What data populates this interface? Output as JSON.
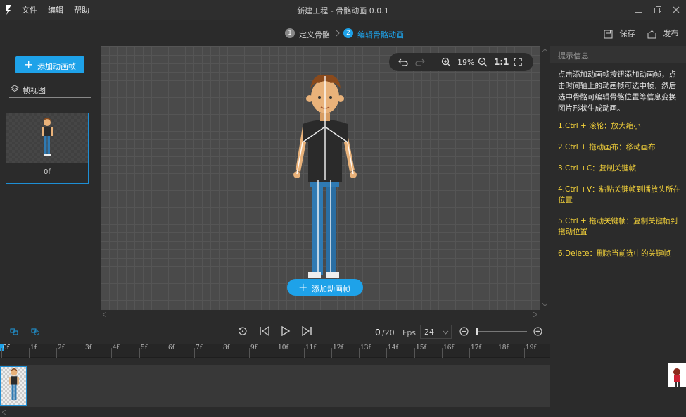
{
  "titlebar": {
    "menu": [
      "文件",
      "编辑",
      "帮助"
    ],
    "title": "新建工程 - 骨骼动画 0.0.1"
  },
  "steps": [
    {
      "num": "1",
      "label": "定义骨骼",
      "active": false
    },
    {
      "num": "2",
      "label": "编辑骨骼动画",
      "active": true
    }
  ],
  "actions": {
    "save": "保存",
    "publish": "发布"
  },
  "left": {
    "add_frame": "添加动画帧",
    "frame_view": "帧视图",
    "thumb_label": "0f"
  },
  "canvas": {
    "zoom": "19%",
    "ratio": "1:1",
    "add_frame": "添加动画帧"
  },
  "tips": {
    "header": "提示信息",
    "desc": "点击添加动画帧按钮添加动画帧，点击时间轴上的动画帧可选中帧，然后选中骨骼可编辑骨骼位置等信息变换图片形状生成动画。",
    "items": [
      "1.Ctrl + 滚轮：放大缩小",
      "2.Ctrl + 拖动画布：移动画布",
      "3.Ctrl +C：复制关键帧",
      "4.Ctrl +V：粘贴关键帧到播放头所在位置",
      "5.Ctrl + 拖动关键帧：复制关键帧到拖动位置",
      "6.Delete：删除当前选中的关键帧"
    ]
  },
  "playback": {
    "current": "0",
    "total": "/20",
    "fps_label": "Fps",
    "fps_value": "24",
    "timeline_zoom": 0.02
  },
  "ruler": [
    "0f",
    "1f",
    "2f",
    "3f",
    "4f",
    "5f",
    "6f",
    "7f",
    "8f",
    "9f",
    "10f",
    "11f",
    "12f",
    "13f",
    "14f",
    "15f",
    "16f",
    "17f",
    "18f",
    "19f"
  ],
  "colors": {
    "accent": "#1ea2e9",
    "tip_yellow": "#f4d23a"
  }
}
